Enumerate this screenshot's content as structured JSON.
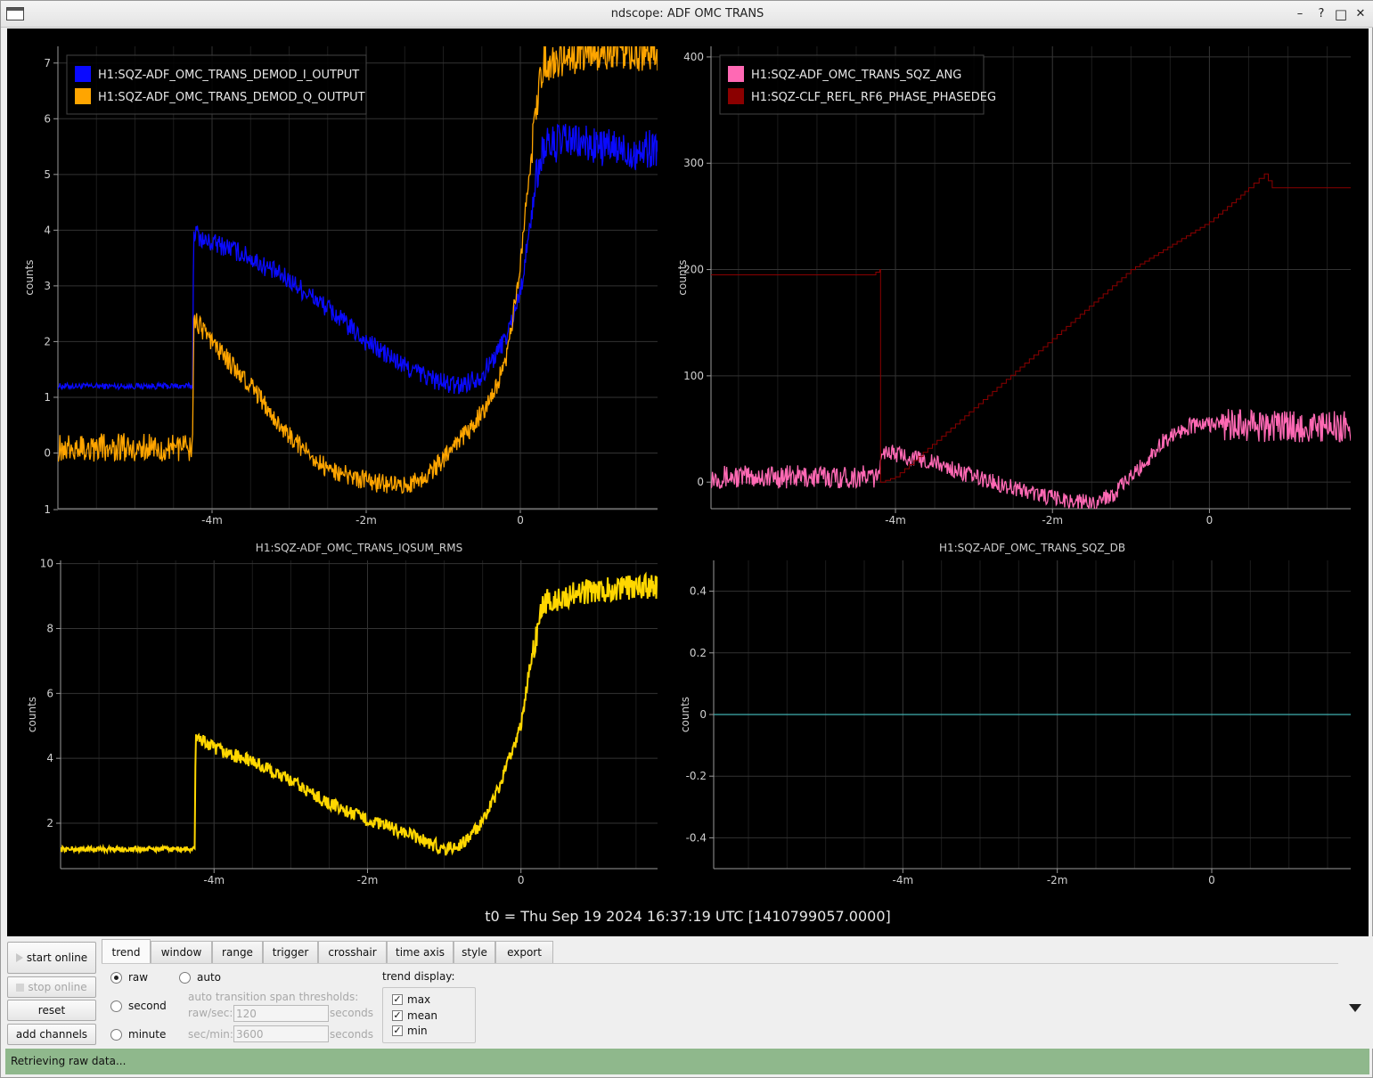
{
  "window": {
    "title": "ndscope: ADF OMC TRANS",
    "minimize_glyph": "–",
    "help_glyph": "?",
    "maximize_glyph": "□",
    "close_glyph": "✕"
  },
  "t0_label": "t0 = Thu Sep 19 2024 16:37:19 UTC [1410799057.0000]",
  "chart_data": [
    {
      "type": "line",
      "title": "",
      "ylabel": "counts",
      "xlabel": "",
      "x_unit": "minutes",
      "xlim": [
        -6.0,
        1.78
      ],
      "ylim": [
        -1,
        7.3
      ],
      "x_ticks": [
        -4,
        -2,
        0
      ],
      "x_tick_labels": [
        "-4m",
        "-2m",
        "0"
      ],
      "y_ticks": [
        1,
        0,
        1,
        2,
        3,
        4,
        5,
        6,
        7
      ],
      "y_tick_labels": [
        "1",
        "0",
        "1",
        "2",
        "3",
        "4",
        "5",
        "6",
        "7"
      ],
      "grid": true,
      "legend": "top-left",
      "series": [
        {
          "name": "H1:SQZ-ADF_OMC_TRANS_DEMOD_I_OUTPUT",
          "color": "#0a0aff",
          "x": [
            -6.0,
            -4.25,
            -4.24,
            -4.1,
            -3.8,
            -3.5,
            -3.0,
            -2.5,
            -2.0,
            -1.5,
            -1.0,
            -0.8,
            -0.5,
            -0.3,
            -0.15,
            0.0,
            0.1,
            0.2,
            0.3,
            0.6,
            1.0,
            1.5,
            1.78
          ],
          "y": [
            1.2,
            1.2,
            4.0,
            3.8,
            3.7,
            3.5,
            3.1,
            2.6,
            2.0,
            1.55,
            1.25,
            1.2,
            1.4,
            1.8,
            2.2,
            2.9,
            3.8,
            4.9,
            5.5,
            5.6,
            5.5,
            5.4,
            5.5
          ]
        },
        {
          "name": "H1:SQZ-ADF_OMC_TRANS_DEMOD_Q_OUTPUT",
          "color": "#ffa500",
          "x": [
            -6.0,
            -4.25,
            -4.24,
            -4.0,
            -3.5,
            -3.0,
            -2.5,
            -2.0,
            -1.5,
            -1.2,
            -1.0,
            -0.6,
            -0.3,
            -0.15,
            0.0,
            0.1,
            0.2,
            0.3,
            0.5,
            1.0,
            1.78
          ],
          "y": [
            0.1,
            0.1,
            2.4,
            2.0,
            1.2,
            0.3,
            -0.3,
            -0.5,
            -0.6,
            -0.4,
            -0.1,
            0.5,
            1.2,
            1.9,
            3.4,
            4.8,
            6.2,
            7.0,
            7.1,
            7.2,
            7.2
          ]
        }
      ]
    },
    {
      "type": "line",
      "title": "",
      "ylabel": "counts",
      "xlabel": "",
      "x_unit": "minutes",
      "xlim": [
        -6.35,
        1.8
      ],
      "ylim": [
        -25,
        410
      ],
      "x_ticks": [
        -4,
        -2,
        0
      ],
      "x_tick_labels": [
        "-4m",
        "-2m",
        "0"
      ],
      "y_ticks": [
        0,
        100,
        200,
        300,
        400
      ],
      "y_tick_labels": [
        "0",
        "100",
        "200",
        "300",
        "400"
      ],
      "grid": true,
      "legend": "top-left",
      "series": [
        {
          "name": "H1:SQZ-ADF_OMC_TRANS_SQZ_ANG",
          "color": "#ff69b4",
          "x": [
            -6.35,
            -4.2,
            -4.19,
            -3.5,
            -3.0,
            -2.5,
            -2.0,
            -1.5,
            -1.2,
            -0.8,
            -0.6,
            -0.3,
            0.0,
            0.5,
            1.0,
            1.8
          ],
          "y": [
            5,
            5,
            30,
            18,
            5,
            -5,
            -15,
            -20,
            -10,
            20,
            38,
            52,
            55,
            53,
            52,
            52
          ]
        },
        {
          "name": "H1:SQZ-CLF_REFL_RF6_PHASE_PHASEDEG",
          "color": "#8b0000",
          "x": [
            -6.35,
            -4.3,
            -4.2,
            -4.19,
            -4.0,
            -3.0,
            -2.0,
            -1.0,
            0.0,
            0.4,
            0.5,
            0.7,
            0.8,
            1.8
          ],
          "y": [
            195,
            195,
            200,
            0,
            5,
            70,
            135,
            200,
            245,
            270,
            277,
            290,
            277,
            277
          ]
        }
      ]
    },
    {
      "type": "line",
      "title": "H1:SQZ-ADF_OMC_TRANS_IQSUM_RMS",
      "ylabel": "counts",
      "xlabel": "",
      "x_unit": "minutes",
      "xlim": [
        -6.0,
        1.78
      ],
      "ylim": [
        0.6,
        10.1
      ],
      "x_ticks": [
        -4,
        -2,
        0
      ],
      "x_tick_labels": [
        "-4m",
        "-2m",
        "0"
      ],
      "y_ticks": [
        2,
        4,
        6,
        8,
        10
      ],
      "y_tick_labels": [
        "2",
        "4",
        "6",
        "8",
        "10"
      ],
      "grid": true,
      "legend": "none",
      "series": [
        {
          "color": "#ffd700",
          "x": [
            -6.0,
            -4.25,
            -4.24,
            -4.0,
            -3.5,
            -3.0,
            -2.5,
            -2.0,
            -1.5,
            -1.0,
            -0.8,
            -0.5,
            -0.3,
            0.0,
            0.1,
            0.2,
            0.3,
            0.6,
            1.0,
            1.78
          ],
          "y": [
            1.2,
            1.2,
            4.7,
            4.3,
            3.9,
            3.3,
            2.6,
            2.1,
            1.7,
            1.2,
            1.3,
            2.0,
            3.0,
            5.0,
            6.6,
            7.8,
            8.8,
            9.0,
            9.2,
            9.3
          ]
        }
      ]
    },
    {
      "type": "line",
      "title": "H1:SQZ-ADF_OMC_TRANS_SQZ_DB",
      "ylabel": "counts",
      "xlabel": "",
      "x_unit": "minutes",
      "xlim": [
        -6.45,
        1.8
      ],
      "ylim": [
        -0.5,
        0.5
      ],
      "x_ticks": [
        -4,
        -2,
        0
      ],
      "x_tick_labels": [
        "-4m",
        "-2m",
        "0"
      ],
      "y_ticks": [
        0.4,
        0.2,
        0,
        -0.2,
        -0.4
      ],
      "y_tick_labels": [
        "0.4",
        "0.2",
        "0",
        "-0.2",
        "-0.4"
      ],
      "grid": true,
      "legend": "none",
      "series": [
        {
          "color": "#40b0b0",
          "x": [
            -6.45,
            1.8
          ],
          "y": [
            0,
            0
          ]
        }
      ]
    }
  ],
  "controls": {
    "start_online": "start online",
    "stop_online": "stop online",
    "reset": "reset",
    "add_channels": "add channels",
    "tabs": [
      "trend",
      "window",
      "range",
      "trigger",
      "crosshair",
      "time axis",
      "style",
      "export"
    ],
    "radios": {
      "raw": "raw",
      "second": "second",
      "minute": "minute",
      "auto": "auto"
    },
    "auto_thresholds_label": "auto transition span thresholds:",
    "raw_sec_label": "raw/sec:",
    "raw_sec_value": "120",
    "sec_min_label": "sec/min:",
    "sec_min_value": "3600",
    "seconds_label": "seconds",
    "trend_display_label": "trend display:",
    "checkboxes": {
      "max": "max",
      "mean": "mean",
      "min": "min"
    },
    "check_glyph": "✓"
  },
  "status": "Retrieving raw data..."
}
